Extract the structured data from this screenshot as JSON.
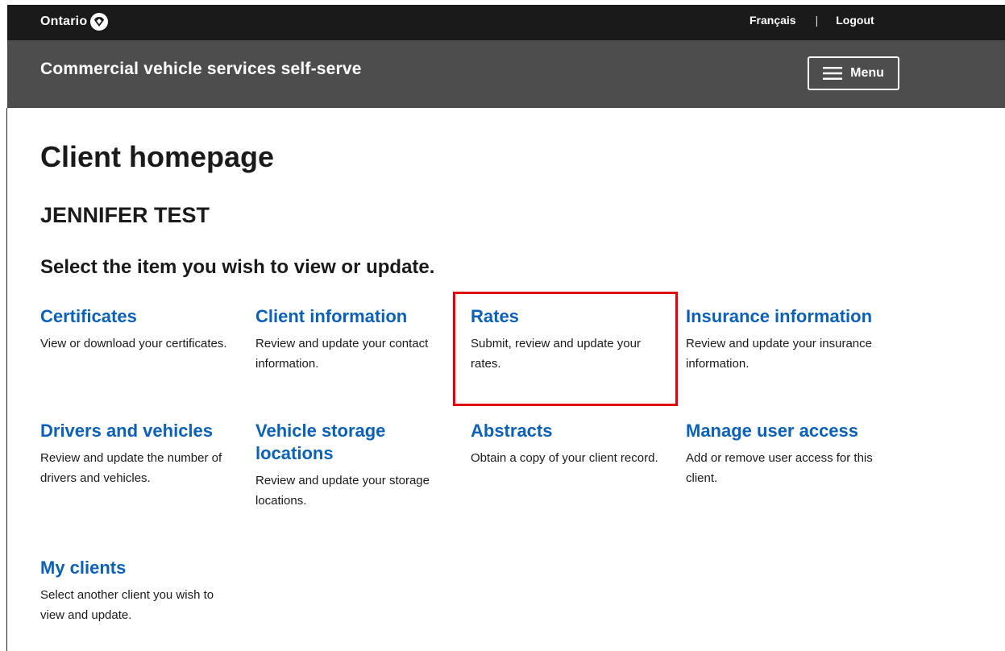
{
  "topbar": {
    "brand": "Ontario",
    "french_link": "Français",
    "separator": "|",
    "logout_link": "Logout"
  },
  "header": {
    "site_title": "Commercial vehicle services self-serve",
    "menu_label": "Menu"
  },
  "main": {
    "page_title": "Client homepage",
    "client_name": "JENNIFER TEST",
    "prompt": "Select the item you wish to view or update.",
    "cards": [
      {
        "title": "Certificates",
        "description": "View or download your certificates."
      },
      {
        "title": "Client information",
        "description": "Review and update your contact information."
      },
      {
        "title": "Rates",
        "description": "Submit, review and update your rates."
      },
      {
        "title": "Insurance information",
        "description": "Review and update your insurance information."
      },
      {
        "title": "Drivers and vehicles",
        "description": "Review and update the number of drivers and vehicles."
      },
      {
        "title": "Vehicle storage locations",
        "description": "Review and update your storage locations."
      },
      {
        "title": "Abstracts",
        "description": "Obtain a copy of your client record."
      },
      {
        "title": "Manage user access",
        "description": "Add or remove user access for this client."
      },
      {
        "title": "My clients",
        "description": "Select another client you wish to view and update."
      }
    ]
  },
  "colors": {
    "topbar": "#1a1a1a",
    "header": "#4d4d4d",
    "link": "#0b60b8",
    "highlight": "#e0000f"
  }
}
